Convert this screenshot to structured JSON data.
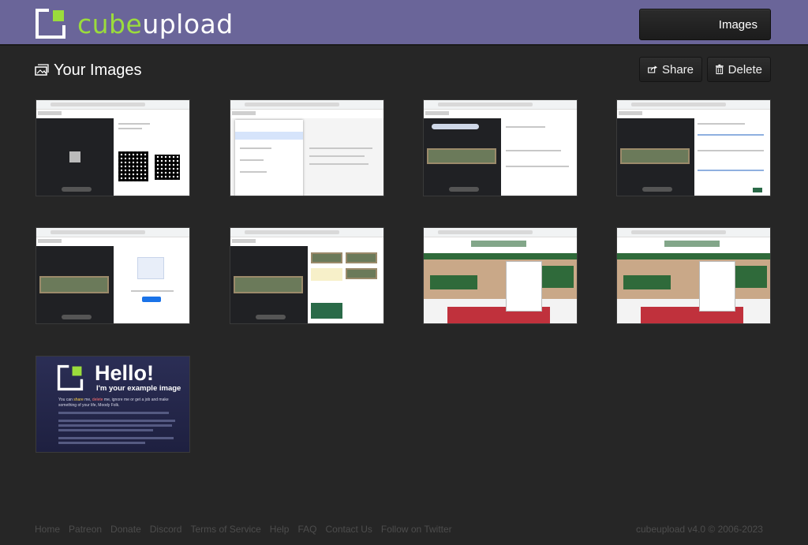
{
  "header": {
    "logo_part1": "cube",
    "logo_part2": "upload",
    "images_button": "Images",
    "colors": {
      "bar": "#6a6599",
      "logo_green": "#9bdc3c"
    }
  },
  "page": {
    "title": "Your Images",
    "title_icon": "image-stack-icon",
    "share_label": "Share",
    "share_icon": "share-icon",
    "delete_label": "Delete",
    "delete_icon": "trash-icon"
  },
  "example_image": {
    "heading": "Hello!",
    "subheading": "I'm your example image",
    "body_prefix": "You can ",
    "share_word": "share",
    "body_mid": " me, ",
    "delete_word": "delete",
    "body_suffix": " me, ignore me or get a job and make something of your life, Moody Folk."
  },
  "footer": {
    "links": [
      "Home",
      "Patreon",
      "Donate",
      "Discord",
      "Terms of Service",
      "Help",
      "FAQ",
      "Contact Us",
      "Follow on Twitter"
    ],
    "copyright": "cubeupload v4.0 © 2006-2023"
  }
}
